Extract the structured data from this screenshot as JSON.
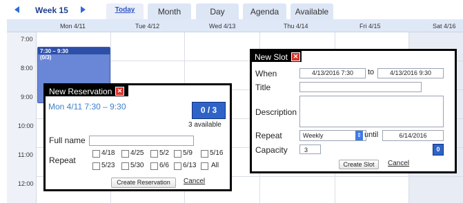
{
  "nav": {
    "week_label": "Week 15",
    "prev_icon": "chevron-left-icon",
    "next_icon": "chevron-right-icon",
    "tabs": [
      {
        "label": "Today"
      },
      {
        "label": "Month"
      },
      {
        "label": "Day"
      },
      {
        "label": "Agenda"
      },
      {
        "label": "Available"
      }
    ]
  },
  "calendar": {
    "days": [
      "Mon 4/11",
      "Tue 4/12",
      "Wed 4/13",
      "Thu 4/14",
      "Fri 4/15",
      "Sat 4/16"
    ],
    "times": [
      "7:00",
      "8:00",
      "9:00",
      "10:00",
      "11:00",
      "12:00"
    ],
    "event": {
      "time": "7:30 – 9:30",
      "count": "(0/3)"
    }
  },
  "reservation_dialog": {
    "title": "New Reservation",
    "close_icon": "close-icon",
    "date_range": "Mon 4/11   7:30 – 9:30",
    "counter": "0 / 3",
    "available": "3 available",
    "full_name_label": "Full name",
    "full_name_value": "",
    "repeat_label": "Repeat",
    "repeat_options": [
      "4/18",
      "4/25",
      "5/2",
      "5/9",
      "5/16",
      "5/23",
      "5/30",
      "6/6",
      "6/13",
      "All"
    ],
    "save_label": "Create Reservation",
    "cancel_label": "Cancel"
  },
  "slot_dialog": {
    "title": "New Slot",
    "close_icon": "close-icon",
    "when_label": "When",
    "from_value": "4/13/2016  7:30",
    "to_label": "to",
    "to_value": "4/13/2016  9:30",
    "title_label": "Title",
    "title_value": "",
    "description_label": "Description",
    "description_value": "",
    "repeat_label": "Repeat",
    "repeat_value": "Weekly",
    "until_label": "until",
    "until_value": "6/14/2016",
    "capacity_label": "Capacity",
    "capacity_value": "3",
    "counter": "0",
    "save_label": "Create Slot",
    "cancel_label": "Cancel"
  }
}
